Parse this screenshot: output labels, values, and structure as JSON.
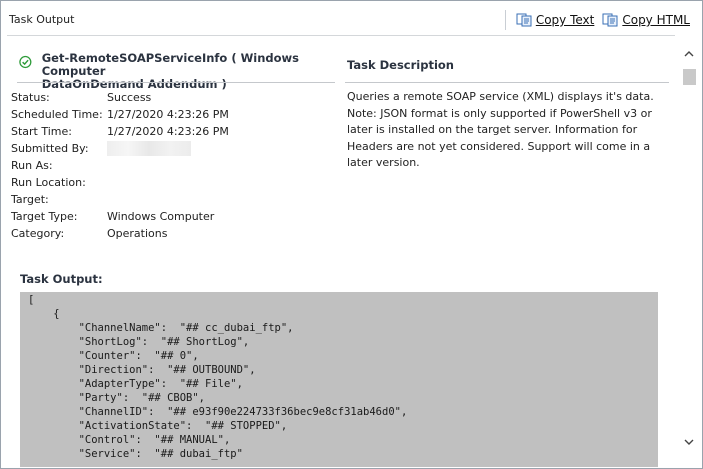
{
  "window": {
    "title": "Task Output"
  },
  "toolbar": {
    "copy_text_label": "Copy Text",
    "copy_html_label": "Copy HTML"
  },
  "task": {
    "title_line1": "Get-RemoteSOAPServiceInfo ( Windows Computer",
    "title_line2": "DataOnDemand Addendum )",
    "status_icon": "success-check-icon"
  },
  "details": [
    {
      "key": "Status:",
      "value": "Success"
    },
    {
      "key": "Scheduled Time:",
      "value": "1/27/2020 4:23:26 PM"
    },
    {
      "key": "Start Time:",
      "value": "1/27/2020 4:23:26 PM"
    },
    {
      "key": "Submitted By:",
      "value": ""
    },
    {
      "key": "Run As:",
      "value": ""
    },
    {
      "key": "Run Location:",
      "value": ""
    },
    {
      "key": "Target:",
      "value": ""
    },
    {
      "key": "Target Type:",
      "value": "Windows Computer"
    },
    {
      "key": "Category:",
      "value": "Operations"
    }
  ],
  "description": {
    "heading": "Task Description",
    "body": "Queries a remote SOAP service (XML) displays it's data. Note: JSON format is only supported if PowerShell v3 or later is installed on the target server. Information for Headers are not yet considered. Support will come in a later version."
  },
  "output": {
    "label": "Task Output:",
    "lines": [
      "[",
      "    {",
      "        \"ChannelName\":  \"## cc_dubai_ftp\",",
      "        \"ShortLog\":  \"## ShortLog\",",
      "        \"Counter\":  \"## 0\",",
      "        \"Direction\":  \"## OUTBOUND\",",
      "        \"AdapterType\":  \"## File\",",
      "        \"Party\":  \"## CBOB\",",
      "        \"ChannelID\":  \"## e93f90e224733f36bec9e8cf31ab46d0\",",
      "        \"ActivationState\":  \"## STOPPED\",",
      "        \"Control\":  \"## MANUAL\",",
      "        \"Service\":  \"## dubai_ftp\""
    ]
  },
  "colors": {
    "code_bg": "#c0c0c0",
    "success": "#2e9b3a",
    "heading": "#2b3340"
  }
}
